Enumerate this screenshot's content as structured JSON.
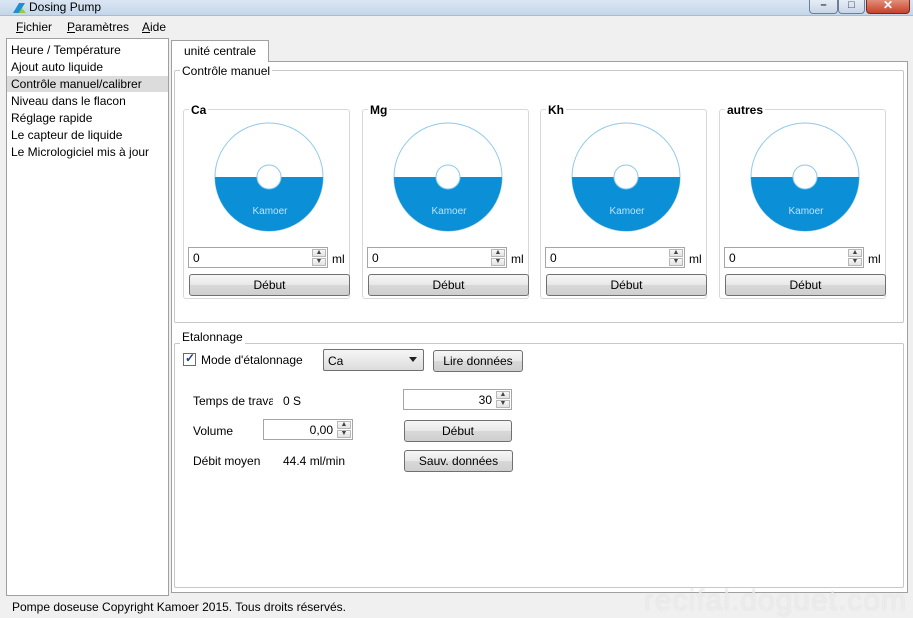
{
  "window": {
    "title": "Dosing Pump",
    "min_glyph": "–",
    "max_glyph": "□",
    "close_glyph": "✕"
  },
  "menu": [
    {
      "first": "F",
      "rest": "ichier"
    },
    {
      "first": "P",
      "rest": "aramètres"
    },
    {
      "first": "A",
      "rest": "ide"
    }
  ],
  "sidebar": {
    "items": [
      "Heure / Température",
      "Ajout auto liquide",
      "Contrôle manuel/calibrer",
      "Niveau dans le flacon",
      "Réglage rapide",
      "Le capteur de liquide",
      "Le Micrologiciel mis à jour"
    ],
    "selected_index": 2
  },
  "tab": {
    "label": "unité centrale"
  },
  "manual": {
    "group_label": "Contrôle manuel",
    "pumps": [
      {
        "name": "Ca",
        "value": "0",
        "unit": "ml",
        "button": "Début",
        "brand": "Kamoer"
      },
      {
        "name": "Mg",
        "value": "0",
        "unit": "ml",
        "button": "Début",
        "brand": "Kamoer"
      },
      {
        "name": "Kh",
        "value": "0",
        "unit": "ml",
        "button": "Début",
        "brand": "Kamoer"
      },
      {
        "name": "autres",
        "value": "0",
        "unit": "ml",
        "button": "Début",
        "brand": "Kamoer"
      }
    ]
  },
  "calibration": {
    "group_label": "Etalonnage",
    "mode_label": "Mode d'étalonnage",
    "mode_checked": true,
    "pump_select": "Ca",
    "read_button": "Lire données",
    "work_time_label": "Temps de trava",
    "work_time_value": "0 S",
    "work_time_input": "30",
    "volume_label": "Volume",
    "volume_value": "0,00",
    "start_button": "Début",
    "flow_label": "Débit moyen",
    "flow_value": "44.4 ml/min",
    "save_button": "Sauv. données"
  },
  "status": {
    "text": "Pompe doseuse Copyright Kamoer 2015. Tous droits réservés."
  },
  "watermark": "recifal.doguet.com",
  "colors": {
    "accent_blue": "#0b8fd6",
    "disc_outline": "#8ec9ec"
  }
}
